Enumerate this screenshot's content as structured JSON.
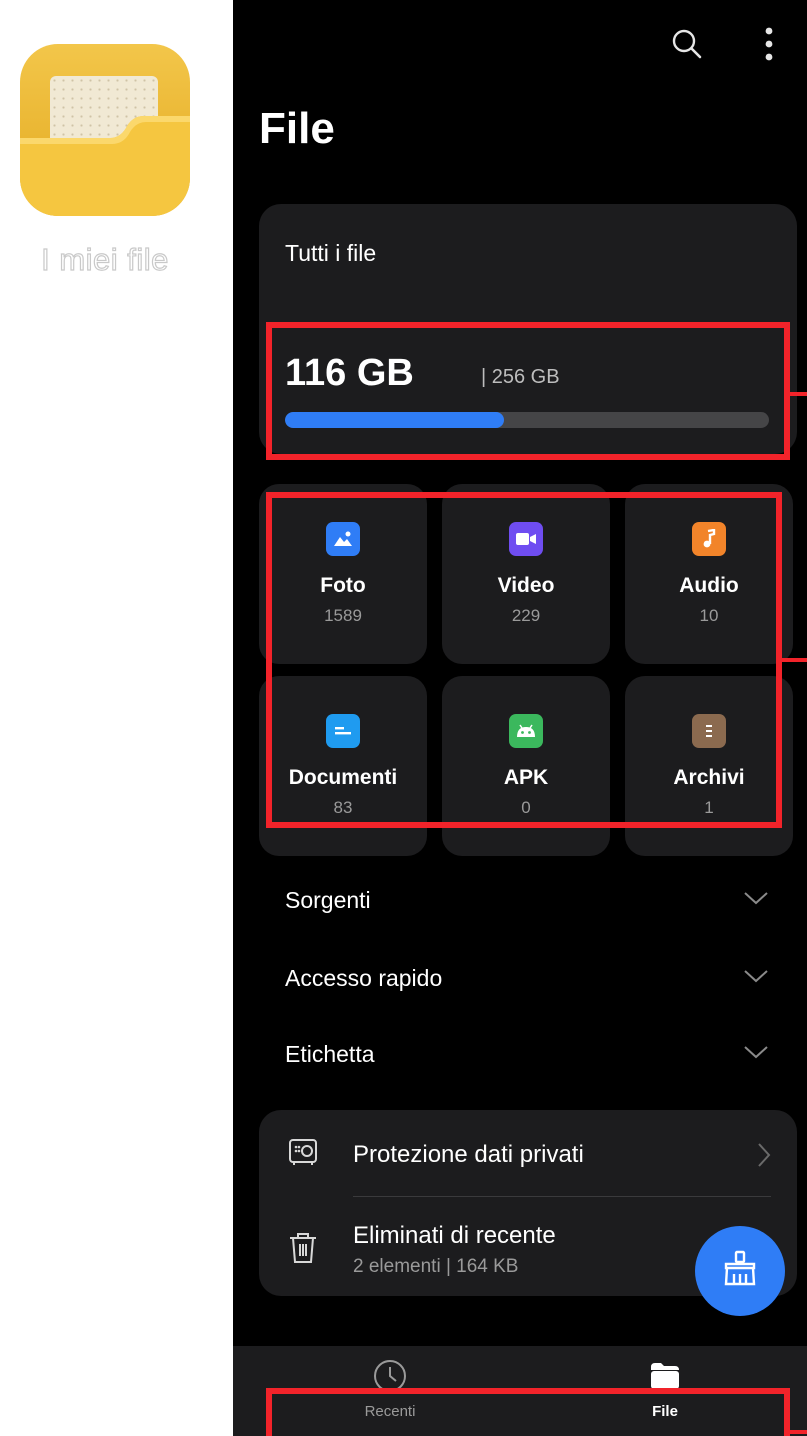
{
  "launcher": {
    "app_label": "I miei file",
    "icon": "folder-app-icon"
  },
  "header": {
    "title": "File",
    "search_icon": "search-icon",
    "menu_icon": "more-vertical-icon"
  },
  "storage": {
    "label": "Tutti i file",
    "used": "116 GB",
    "total": "| 256 GB",
    "used_fraction": 0.453,
    "bar_color": "#2f7df6"
  },
  "categories": [
    {
      "name": "Foto",
      "count": "1589",
      "icon": "image-icon",
      "color": "#2f7df6"
    },
    {
      "name": "Video",
      "count": "229",
      "icon": "video-icon",
      "color": "#6f4df1"
    },
    {
      "name": "Audio",
      "count": "10",
      "icon": "music-note-icon",
      "color": "#f2842a"
    },
    {
      "name": "Documenti",
      "count": "83",
      "icon": "document-icon",
      "color": "#1f9bf0"
    },
    {
      "name": "APK",
      "count": "0",
      "icon": "android-icon",
      "color": "#3bb85d"
    },
    {
      "name": "Archivi",
      "count": "1",
      "icon": "archive-icon",
      "color": "#8b6a4f"
    }
  ],
  "sections": [
    {
      "label": "Sorgenti"
    },
    {
      "label": "Accesso rapido"
    },
    {
      "label": "Etichetta"
    }
  ],
  "privacy": {
    "protection_label": "Protezione dati privati",
    "deleted_label": "Eliminati di recente",
    "deleted_sub": "2 elementi  |  164 KB"
  },
  "nav": {
    "recent_label": "Recenti",
    "files_label": "File"
  },
  "annotation_color": "#f2232a"
}
